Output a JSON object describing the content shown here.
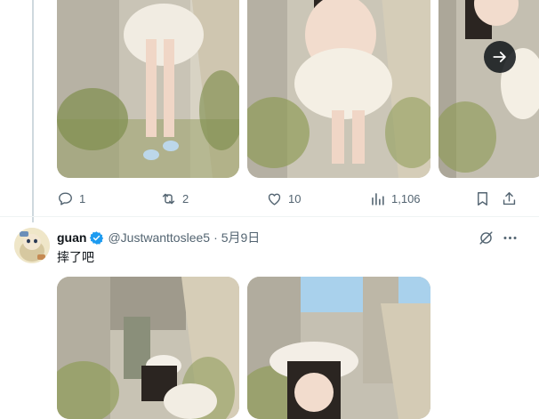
{
  "first_tweet": {
    "media_alts": [
      "photo-1",
      "photo-2",
      "photo-3"
    ],
    "actions": {
      "replies": "1",
      "reposts": "2",
      "likes": "10",
      "views": "1,106"
    }
  },
  "second_tweet": {
    "display_name": "guan",
    "handle": "@Justwanttoslee5",
    "separator": "·",
    "date": "5月9日",
    "text": "摔了吧",
    "media_alts": [
      "photo-1",
      "photo-2"
    ]
  },
  "colors": {
    "text_primary": "#0f1419",
    "text_secondary": "#536471",
    "verified_blue": "#1d9bf0",
    "divider": "#eff3f4"
  },
  "icons": {
    "reply": "reply-icon",
    "repost": "repost-icon",
    "like": "heart-icon",
    "views": "views-icon",
    "bookmark": "bookmark-icon",
    "share": "share-icon",
    "next": "arrow-right-icon",
    "grok": "grok-icon",
    "more": "more-icon",
    "verified": "verified-badge-icon"
  }
}
